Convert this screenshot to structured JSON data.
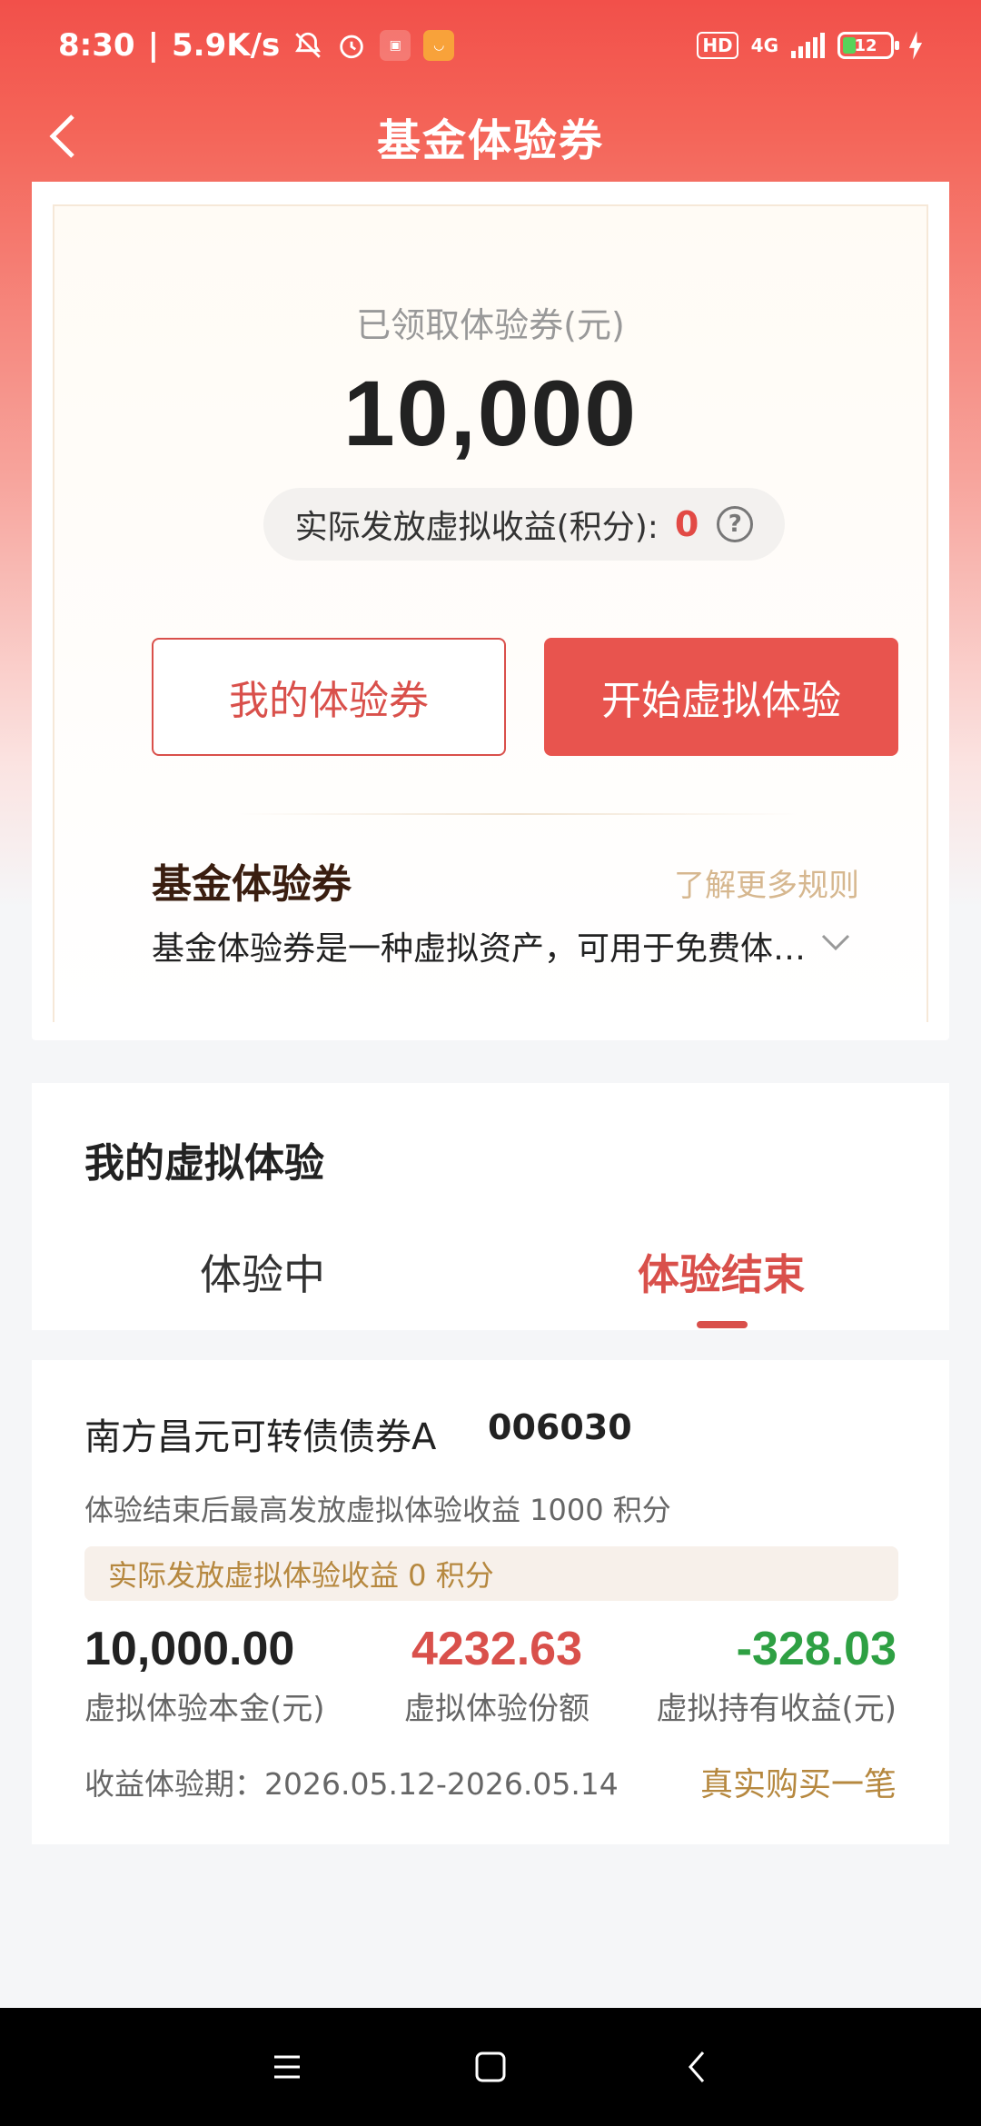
{
  "status_bar": {
    "time": "8:30",
    "speed": "5.9K/s",
    "network": "4G",
    "hd": "HD",
    "battery": "12"
  },
  "nav": {
    "title": "基金体验券"
  },
  "voucher": {
    "received_label": "已领取体验券(元)",
    "received_value": "10,000",
    "earned_label": "实际发放虚拟收益(积分):",
    "earned_value": "0",
    "my_vouchers_button": "我的体验券",
    "start_button": "开始虚拟体验"
  },
  "rules": {
    "title": "基金体验券",
    "more_link": "了解更多规则",
    "description": "基金体验券是一种虚拟资产，可用于免费体…"
  },
  "my_experience": {
    "title": "我的虚拟体验",
    "tabs": [
      "体验中",
      "体验结束"
    ],
    "active_tab": 1
  },
  "fund": {
    "name": "南方昌元可转债债券A",
    "code": "006030",
    "max_note": "体验结束后最高发放虚拟体验收益 1000 积分",
    "actual_note": "实际发放虚拟体验收益 0 积分",
    "principal_value": "10,000.00",
    "principal_label": "虚拟体验本金(元)",
    "shares_value": "4232.63",
    "shares_label": "虚拟体验份额",
    "profit_value": "-328.03",
    "profit_label": "虚拟持有收益(元)",
    "period": "收益体验期：2026.05.12-2026.05.14",
    "buy_link": "真实购买一笔"
  },
  "colors": {
    "brand_red": "#e8544e",
    "gold": "#b6883f",
    "profit_green": "#2ea043"
  }
}
